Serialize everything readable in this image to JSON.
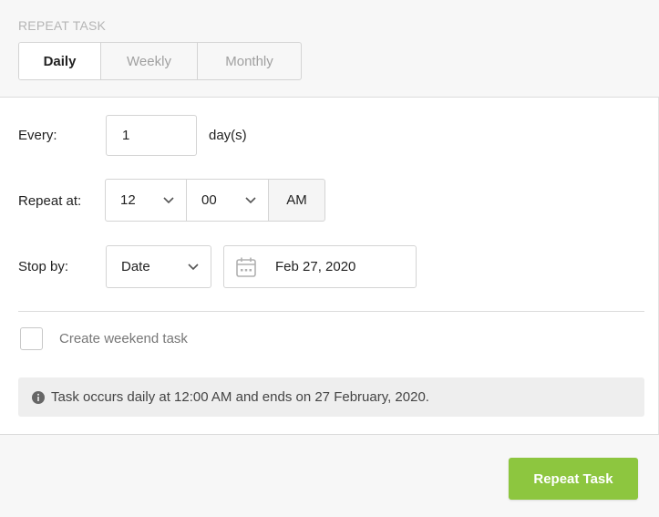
{
  "header": {
    "title": "REPEAT TASK",
    "tabs": [
      {
        "label": "Daily",
        "active": true
      },
      {
        "label": "Weekly",
        "active": false
      },
      {
        "label": "Monthly",
        "active": false
      }
    ]
  },
  "every": {
    "label": "Every:",
    "value": "1",
    "unit": "day(s)"
  },
  "repeat_at": {
    "label": "Repeat at:",
    "hour": "12",
    "minute": "00",
    "meridiem": "AM"
  },
  "stop_by": {
    "label": "Stop by:",
    "mode": "Date",
    "date": "Feb 27, 2020"
  },
  "weekend": {
    "label": "Create weekend task",
    "checked": false
  },
  "info": {
    "text": "Task occurs daily at 12:00 AM and ends on 27 February, 2020."
  },
  "footer": {
    "primary_button": "Repeat Task"
  },
  "colors": {
    "accent": "#8dc63f",
    "header_bg": "#f7f7f7",
    "border": "#d4d4d4",
    "info_bg": "#eeeeee"
  },
  "icons": {
    "select_chevron": "chevron-down-icon",
    "date": "calendar-icon",
    "info": "info-icon"
  }
}
